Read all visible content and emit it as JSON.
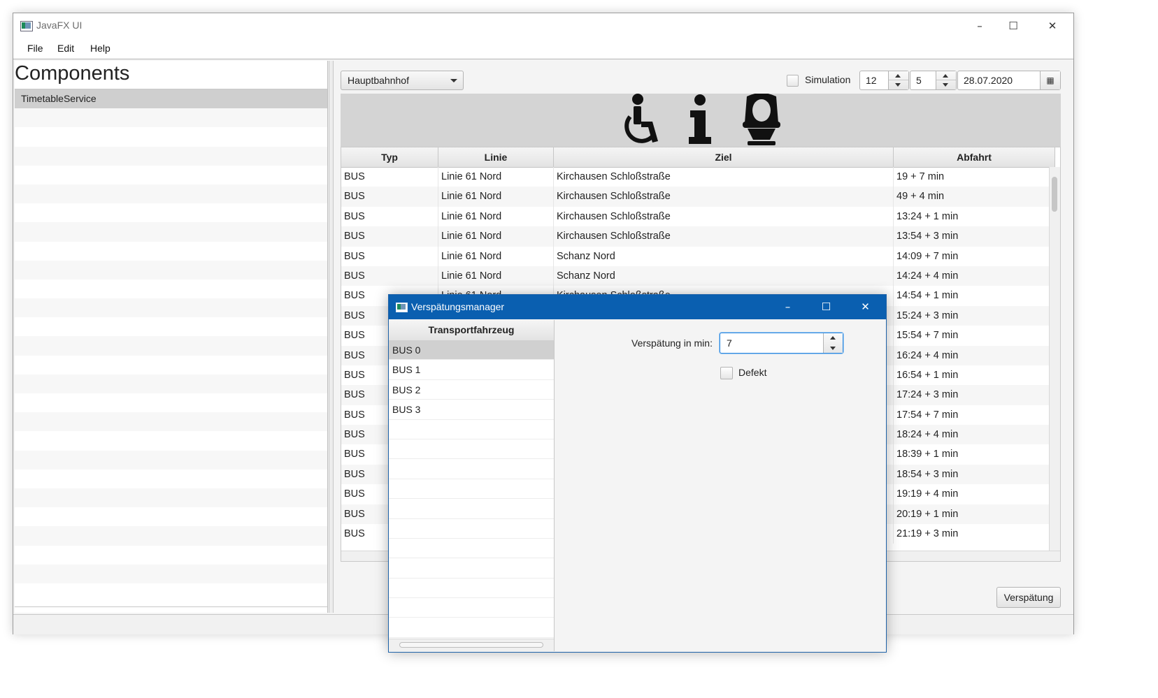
{
  "window": {
    "title": "JavaFX UI",
    "controls": {
      "minimize": "–",
      "maximize": "☐",
      "close": "✕"
    }
  },
  "menu": [
    "File",
    "Edit",
    "Help"
  ],
  "sidebar": {
    "title": "Components",
    "items": [
      "TimetableService"
    ]
  },
  "toolbar": {
    "station": "Hauptbahnhof",
    "simulation_label": "Simulation",
    "hour": "12",
    "minute": "5",
    "date": "28.07.2020"
  },
  "icons": [
    "wheelchair-icon",
    "info-icon",
    "toilet-icon"
  ],
  "table": {
    "columns": [
      "Typ",
      "Linie",
      "Ziel",
      "Abfahrt"
    ],
    "rows": [
      [
        "BUS",
        "Linie 61 Nord",
        "Kirchausen Schloßstraße",
        "19 + 7 min"
      ],
      [
        "BUS",
        "Linie 61 Nord",
        "Kirchausen Schloßstraße",
        "49 + 4 min"
      ],
      [
        "BUS",
        "Linie 61 Nord",
        "Kirchausen Schloßstraße",
        "13:24 + 1 min"
      ],
      [
        "BUS",
        "Linie 61 Nord",
        "Kirchausen Schloßstraße",
        "13:54 + 3 min"
      ],
      [
        "BUS",
        "Linie 61 Nord",
        "Schanz Nord",
        "14:09 + 7 min"
      ],
      [
        "BUS",
        "Linie 61 Nord",
        "Schanz Nord",
        "14:24 + 4 min"
      ],
      [
        "BUS",
        "Linie 61 Nord",
        "Kirchausen Schloßstraße",
        "14:54 + 1 min"
      ],
      [
        "BUS",
        "",
        "",
        "15:24 + 3 min"
      ],
      [
        "BUS",
        "",
        "",
        "15:54 + 7 min"
      ],
      [
        "BUS",
        "",
        "",
        "16:24 + 4 min"
      ],
      [
        "BUS",
        "",
        "",
        "16:54 + 1 min"
      ],
      [
        "BUS",
        "",
        "",
        "17:24 + 3 min"
      ],
      [
        "BUS",
        "",
        "",
        "17:54 + 7 min"
      ],
      [
        "BUS",
        "",
        "",
        "18:24 + 4 min"
      ],
      [
        "BUS",
        "",
        "",
        "18:39 + 1 min"
      ],
      [
        "BUS",
        "",
        "",
        "18:54 + 3 min"
      ],
      [
        "BUS",
        "",
        "",
        "19:19 + 4 min"
      ],
      [
        "BUS",
        "",
        "",
        "20:19 + 1 min"
      ],
      [
        "BUS",
        "",
        "",
        "21:19 + 3 min"
      ]
    ]
  },
  "delay_button": "Verspätung",
  "dialog": {
    "title": "Verspätungsmanager",
    "controls": {
      "minimize": "–",
      "maximize": "☐",
      "close": "✕"
    },
    "vehicle_header": "Transportfahrzeug",
    "vehicles": [
      "BUS 0",
      "BUS 1",
      "BUS 2",
      "BUS 3"
    ],
    "delay_label": "Verspätung in min:",
    "delay_value": "7",
    "defect_label": "Defekt"
  }
}
